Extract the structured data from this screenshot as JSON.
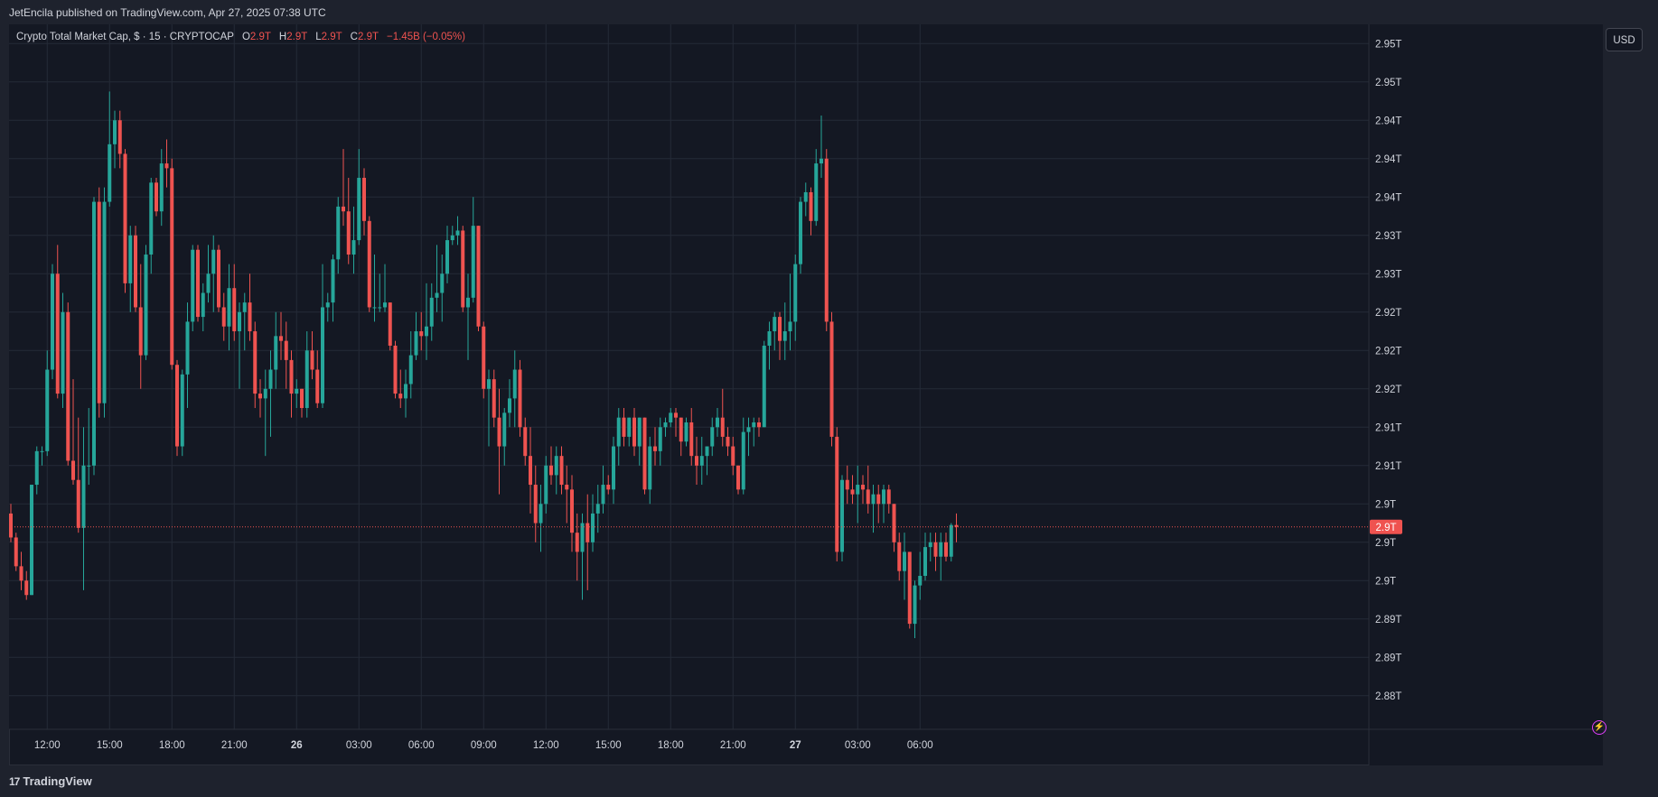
{
  "publisher_line": "JetEncila published on TradingView.com, Apr 27, 2025 07:38 UTC",
  "legend": {
    "symbol": "Crypto Total Market Cap, $ · 15 · CRYPTOCAP",
    "o_label": "O",
    "o_value": "2.9T",
    "h_label": "H",
    "h_value": "2.9T",
    "l_label": "L",
    "l_value": "2.9T",
    "c_label": "C",
    "c_value": "2.9T",
    "change": "−1.45B (−0.05%)"
  },
  "currency_button": "USD",
  "price_tag": "2.9T",
  "footer": {
    "logo_text": "TradingView",
    "logo_mark": "17"
  },
  "colors": {
    "background": "#141823",
    "grid": "#242a37",
    "up": "#26a69a",
    "down": "#ef5350",
    "text": "#d1d4dc",
    "price_line": "#ef5350"
  },
  "chart_data": {
    "type": "candlestick",
    "symbol": "CRYPTOCAP:TOTAL",
    "interval": "15",
    "ylim": [
      2.8805,
      2.954
    ],
    "y_ticks": [
      {
        "value": 2.952,
        "label": "2.95T"
      },
      {
        "value": 2.948,
        "label": "2.95T"
      },
      {
        "value": 2.944,
        "label": "2.94T"
      },
      {
        "value": 2.94,
        "label": "2.94T"
      },
      {
        "value": 2.936,
        "label": "2.94T"
      },
      {
        "value": 2.932,
        "label": "2.93T"
      },
      {
        "value": 2.928,
        "label": "2.93T"
      },
      {
        "value": 2.924,
        "label": "2.92T"
      },
      {
        "value": 2.92,
        "label": "2.92T"
      },
      {
        "value": 2.916,
        "label": "2.92T"
      },
      {
        "value": 2.912,
        "label": "2.91T"
      },
      {
        "value": 2.908,
        "label": "2.91T"
      },
      {
        "value": 2.904,
        "label": "2.9T"
      },
      {
        "value": 2.9,
        "label": "2.9T"
      },
      {
        "value": 2.896,
        "label": "2.9T"
      },
      {
        "value": 2.892,
        "label": "2.89T"
      },
      {
        "value": 2.888,
        "label": "2.89T"
      },
      {
        "value": 2.884,
        "label": "2.88T"
      }
    ],
    "x_ticks": [
      {
        "bar": 7,
        "label": "12:00"
      },
      {
        "bar": 19,
        "label": "15:00"
      },
      {
        "bar": 31,
        "label": "18:00"
      },
      {
        "bar": 43,
        "label": "21:00"
      },
      {
        "bar": 55,
        "label": "26"
      },
      {
        "bar": 67,
        "label": "03:00"
      },
      {
        "bar": 79,
        "label": "06:00"
      },
      {
        "bar": 91,
        "label": "09:00"
      },
      {
        "bar": 103,
        "label": "12:00"
      },
      {
        "bar": 115,
        "label": "15:00"
      },
      {
        "bar": 127,
        "label": "18:00"
      },
      {
        "bar": 139,
        "label": "21:00"
      },
      {
        "bar": 151,
        "label": "27"
      },
      {
        "bar": 163,
        "label": "03:00"
      },
      {
        "bar": 175,
        "label": "06:00"
      }
    ],
    "last_price": 2.9016,
    "ohlc": [
      [
        2.903,
        2.904,
        2.9,
        2.9005
      ],
      [
        2.9005,
        2.901,
        2.897,
        2.8975
      ],
      [
        2.8975,
        2.899,
        2.895,
        2.896
      ],
      [
        2.896,
        2.897,
        2.894,
        2.8945
      ],
      [
        2.8945,
        2.906,
        2.8945,
        2.906
      ],
      [
        2.906,
        2.91,
        2.905,
        2.9095
      ],
      [
        2.9095,
        2.91,
        2.908,
        2.9095
      ],
      [
        2.9095,
        2.92,
        2.909,
        2.918
      ],
      [
        2.918,
        2.929,
        2.917,
        2.928
      ],
      [
        2.928,
        2.931,
        2.915,
        2.9155
      ],
      [
        2.9155,
        2.926,
        2.914,
        2.924
      ],
      [
        2.924,
        2.925,
        2.908,
        2.9085
      ],
      [
        2.9085,
        2.917,
        2.906,
        2.9065
      ],
      [
        2.9065,
        2.913,
        2.901,
        2.9015
      ],
      [
        2.9015,
        2.912,
        2.895,
        2.908
      ],
      [
        2.908,
        2.914,
        2.906,
        2.908
      ],
      [
        2.908,
        2.936,
        2.907,
        2.9355
      ],
      [
        2.9355,
        2.937,
        2.913,
        2.9145
      ],
      [
        2.9145,
        2.937,
        2.913,
        2.9355
      ],
      [
        2.9355,
        2.947,
        2.935,
        2.9415
      ],
      [
        2.9415,
        2.945,
        2.939,
        2.944
      ],
      [
        2.944,
        2.945,
        2.939,
        2.9405
      ],
      [
        2.9405,
        2.941,
        2.926,
        2.927
      ],
      [
        2.927,
        2.933,
        2.924,
        2.932
      ],
      [
        2.932,
        2.933,
        2.924,
        2.9245
      ],
      [
        2.9245,
        2.929,
        2.916,
        2.9195
      ],
      [
        2.9195,
        2.931,
        2.919,
        2.93
      ],
      [
        2.93,
        2.938,
        2.928,
        2.9375
      ],
      [
        2.9375,
        2.938,
        2.934,
        2.9345
      ],
      [
        2.9345,
        2.941,
        2.933,
        2.9395
      ],
      [
        2.9395,
        2.942,
        2.937,
        2.939
      ],
      [
        2.939,
        2.94,
        2.918,
        2.9185
      ],
      [
        2.9185,
        2.919,
        2.909,
        2.91
      ],
      [
        2.91,
        2.918,
        2.909,
        2.9175
      ],
      [
        2.9175,
        2.925,
        2.914,
        2.923
      ],
      [
        2.923,
        2.931,
        2.922,
        2.9305
      ],
      [
        2.9305,
        2.931,
        2.923,
        2.9235
      ],
      [
        2.9235,
        2.927,
        2.922,
        2.926
      ],
      [
        2.926,
        2.931,
        2.925,
        2.928
      ],
      [
        2.928,
        2.932,
        2.924,
        2.9305
      ],
      [
        2.9305,
        2.931,
        2.924,
        2.9245
      ],
      [
        2.9245,
        2.926,
        2.921,
        2.9225
      ],
      [
        2.9225,
        2.929,
        2.92,
        2.9265
      ],
      [
        2.9265,
        2.929,
        2.921,
        2.922
      ],
      [
        2.922,
        2.925,
        2.916,
        2.924
      ],
      [
        2.924,
        2.926,
        2.92,
        2.925
      ],
      [
        2.925,
        2.928,
        2.921,
        2.922
      ],
      [
        2.922,
        2.923,
        2.914,
        2.9155
      ],
      [
        2.9155,
        2.917,
        2.913,
        2.915
      ],
      [
        2.915,
        2.918,
        2.909,
        2.916
      ],
      [
        2.916,
        2.92,
        2.911,
        2.918
      ],
      [
        2.918,
        2.924,
        2.916,
        2.9215
      ],
      [
        2.9215,
        2.924,
        2.919,
        2.921
      ],
      [
        2.921,
        2.923,
        2.916,
        2.919
      ],
      [
        2.919,
        2.92,
        2.913,
        2.9155
      ],
      [
        2.9155,
        2.917,
        2.914,
        2.916
      ],
      [
        2.916,
        2.916,
        2.913,
        2.914
      ],
      [
        2.914,
        2.922,
        2.913,
        2.92
      ],
      [
        2.92,
        2.922,
        2.917,
        2.918
      ],
      [
        2.918,
        2.92,
        2.914,
        2.9145
      ],
      [
        2.9145,
        2.929,
        2.914,
        2.9245
      ],
      [
        2.9245,
        2.926,
        2.923,
        2.925
      ],
      [
        2.925,
        2.93,
        2.923,
        2.9295
      ],
      [
        2.9295,
        2.936,
        2.928,
        2.935
      ],
      [
        2.935,
        2.941,
        2.933,
        2.9345
      ],
      [
        2.9345,
        2.938,
        2.929,
        2.93
      ],
      [
        2.93,
        2.935,
        2.928,
        2.9315
      ],
      [
        2.9315,
        2.941,
        2.931,
        2.938
      ],
      [
        2.938,
        2.939,
        2.932,
        2.9335
      ],
      [
        2.9335,
        2.934,
        2.924,
        2.9245
      ],
      [
        2.9245,
        2.93,
        2.923,
        2.9245
      ],
      [
        2.9245,
        2.928,
        2.924,
        2.9245
      ],
      [
        2.9245,
        2.929,
        2.924,
        2.925
      ],
      [
        2.925,
        2.925,
        2.92,
        2.9205
      ],
      [
        2.9205,
        2.921,
        2.915,
        2.9155
      ],
      [
        2.9155,
        2.918,
        2.914,
        2.915
      ],
      [
        2.915,
        2.918,
        2.913,
        2.9165
      ],
      [
        2.9165,
        2.922,
        2.915,
        2.9195
      ],
      [
        2.9195,
        2.924,
        2.919,
        2.922
      ],
      [
        2.922,
        2.924,
        2.92,
        2.9215
      ],
      [
        2.9215,
        2.927,
        2.919,
        2.9225
      ],
      [
        2.9225,
        2.927,
        2.921,
        2.9255
      ],
      [
        2.9255,
        2.931,
        2.924,
        2.926
      ],
      [
        2.926,
        2.93,
        2.923,
        2.928
      ],
      [
        2.928,
        2.933,
        2.927,
        2.9315
      ],
      [
        2.9315,
        2.933,
        2.931,
        2.932
      ],
      [
        2.932,
        2.934,
        2.931,
        2.9325
      ],
      [
        2.9325,
        2.933,
        2.924,
        2.9245
      ],
      [
        2.9245,
        2.928,
        2.919,
        2.9255
      ],
      [
        2.9255,
        2.936,
        2.925,
        2.933
      ],
      [
        2.933,
        2.933,
        2.922,
        2.9225
      ],
      [
        2.9225,
        2.923,
        2.915,
        2.916
      ],
      [
        2.916,
        2.918,
        2.91,
        2.917
      ],
      [
        2.917,
        2.918,
        2.912,
        2.913
      ],
      [
        2.913,
        2.916,
        2.905,
        2.91
      ],
      [
        2.91,
        2.914,
        2.908,
        2.9135
      ],
      [
        2.9135,
        2.917,
        2.912,
        2.915
      ],
      [
        2.915,
        2.92,
        2.912,
        2.918
      ],
      [
        2.918,
        2.919,
        2.911,
        2.912
      ],
      [
        2.912,
        2.913,
        2.908,
        2.909
      ],
      [
        2.909,
        2.912,
        2.903,
        2.906
      ],
      [
        2.906,
        2.908,
        2.9,
        2.902
      ],
      [
        2.902,
        2.906,
        2.899,
        2.904
      ],
      [
        2.904,
        2.909,
        2.903,
        2.908
      ],
      [
        2.908,
        2.91,
        2.906,
        2.907
      ],
      [
        2.907,
        2.91,
        2.905,
        2.909
      ],
      [
        2.909,
        2.91,
        2.905,
        2.906
      ],
      [
        2.906,
        2.908,
        2.902,
        2.9055
      ],
      [
        2.9055,
        2.907,
        2.899,
        2.901
      ],
      [
        2.901,
        2.903,
        2.896,
        2.899
      ],
      [
        2.899,
        2.903,
        2.894,
        2.902
      ],
      [
        2.902,
        2.905,
        2.895,
        2.9
      ],
      [
        2.9,
        2.905,
        2.899,
        2.903
      ],
      [
        2.903,
        2.906,
        2.901,
        2.904
      ],
      [
        2.904,
        2.908,
        2.903,
        2.906
      ],
      [
        2.906,
        2.907,
        2.905,
        2.9055
      ],
      [
        2.9055,
        2.911,
        2.904,
        2.91
      ],
      [
        2.91,
        2.914,
        2.908,
        2.913
      ],
      [
        2.913,
        2.914,
        2.91,
        2.911
      ],
      [
        2.911,
        2.913,
        2.91,
        2.913
      ],
      [
        2.913,
        2.914,
        2.909,
        2.91
      ],
      [
        2.91,
        2.913,
        2.908,
        2.913
      ],
      [
        2.913,
        2.913,
        2.905,
        2.9055
      ],
      [
        2.9055,
        2.911,
        2.904,
        2.91
      ],
      [
        2.91,
        2.912,
        2.908,
        2.9095
      ],
      [
        2.9095,
        2.913,
        2.908,
        2.912
      ],
      [
        2.912,
        2.913,
        2.911,
        2.9125
      ],
      [
        2.9125,
        2.914,
        2.912,
        2.9135
      ],
      [
        2.9135,
        2.914,
        2.911,
        2.913
      ],
      [
        2.913,
        2.913,
        2.909,
        2.9105
      ],
      [
        2.9105,
        2.913,
        2.91,
        2.9125
      ],
      [
        2.9125,
        2.914,
        2.908,
        2.909
      ],
      [
        2.909,
        2.911,
        2.906,
        2.908
      ],
      [
        2.908,
        2.911,
        2.906,
        2.909
      ],
      [
        2.909,
        2.91,
        2.907,
        2.91
      ],
      [
        2.91,
        2.913,
        2.909,
        2.912
      ],
      [
        2.912,
        2.914,
        2.911,
        2.913
      ],
      [
        2.913,
        2.916,
        2.91,
        2.911
      ],
      [
        2.911,
        2.912,
        2.909,
        2.91
      ],
      [
        2.91,
        2.911,
        2.907,
        2.908
      ],
      [
        2.908,
        2.908,
        2.905,
        2.9055
      ],
      [
        2.9055,
        2.913,
        2.905,
        2.9115
      ],
      [
        2.9115,
        2.913,
        2.909,
        2.912
      ],
      [
        2.912,
        2.913,
        2.91,
        2.9125
      ],
      [
        2.9125,
        2.913,
        2.911,
        2.912
      ],
      [
        2.912,
        2.921,
        2.912,
        2.9205
      ],
      [
        2.9205,
        2.923,
        2.918,
        2.922
      ],
      [
        2.922,
        2.924,
        2.92,
        2.9235
      ],
      [
        2.9235,
        2.924,
        2.919,
        2.921
      ],
      [
        2.921,
        2.925,
        2.919,
        2.922
      ],
      [
        2.922,
        2.928,
        2.92,
        2.923
      ],
      [
        2.923,
        2.93,
        2.921,
        2.929
      ],
      [
        2.929,
        2.936,
        2.928,
        2.9355
      ],
      [
        2.9355,
        2.9375,
        2.934,
        2.9365
      ],
      [
        2.9365,
        2.937,
        2.932,
        2.9335
      ],
      [
        2.9335,
        2.941,
        2.933,
        2.9395
      ],
      [
        2.9395,
        2.9445,
        2.938,
        2.94
      ],
      [
        2.94,
        2.941,
        2.922,
        2.923
      ],
      [
        2.923,
        2.924,
        2.91,
        2.911
      ],
      [
        2.911,
        2.912,
        2.898,
        2.899
      ],
      [
        2.899,
        2.907,
        2.898,
        2.9065
      ],
      [
        2.9065,
        2.908,
        2.904,
        2.9055
      ],
      [
        2.9055,
        2.907,
        2.904,
        2.905
      ],
      [
        2.905,
        2.908,
        2.902,
        2.906
      ],
      [
        2.906,
        2.907,
        2.904,
        2.9055
      ],
      [
        2.9055,
        2.908,
        2.903,
        2.904
      ],
      [
        2.904,
        2.906,
        2.901,
        2.905
      ],
      [
        2.905,
        2.906,
        2.902,
        2.904
      ],
      [
        2.904,
        2.906,
        2.902,
        2.9055
      ],
      [
        2.9055,
        2.906,
        2.903,
        2.904
      ],
      [
        2.904,
        2.904,
        2.899,
        2.9
      ],
      [
        2.9,
        2.901,
        2.896,
        2.897
      ],
      [
        2.897,
        2.901,
        2.894,
        2.899
      ],
      [
        2.899,
        2.899,
        2.891,
        2.8915
      ],
      [
        2.8915,
        2.896,
        2.89,
        2.8955
      ],
      [
        2.8955,
        2.899,
        2.894,
        2.8965
      ],
      [
        2.8965,
        2.901,
        2.896,
        2.8995
      ],
      [
        2.8995,
        2.901,
        2.898,
        2.9
      ],
      [
        2.9,
        2.901,
        2.897,
        2.8985
      ],
      [
        2.8985,
        2.901,
        2.896,
        2.9
      ],
      [
        2.9,
        2.901,
        2.898,
        2.8985
      ],
      [
        2.8985,
        2.902,
        2.898,
        2.9018
      ],
      [
        2.9018,
        2.903,
        2.9,
        2.9016
      ]
    ]
  }
}
